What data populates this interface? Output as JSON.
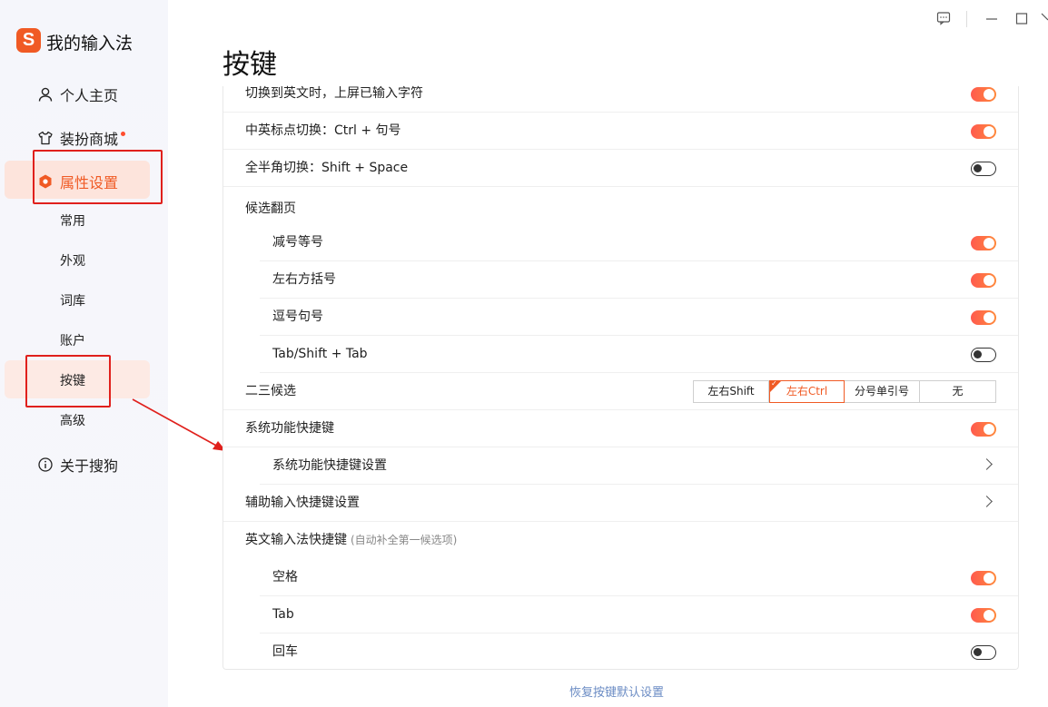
{
  "app": {
    "logo_glyph": "S",
    "title": "我的输入法"
  },
  "sidebar": {
    "items": [
      {
        "label": "个人主页",
        "icon": "user-icon"
      },
      {
        "label": "装扮商城",
        "icon": "shirt-icon",
        "badge_dot": true
      },
      {
        "label": "属性设置",
        "icon": "settings-hex-icon",
        "active": true
      },
      {
        "label": "关于搜狗",
        "icon": "info-icon"
      }
    ],
    "subitems": [
      {
        "label": "常用"
      },
      {
        "label": "外观"
      },
      {
        "label": "词库"
      },
      {
        "label": "账户"
      },
      {
        "label": "按键",
        "active": true
      },
      {
        "label": "高级"
      }
    ]
  },
  "window_controls": [
    "feedback-icon",
    "minimize-icon",
    "maximize-icon",
    "close-icon"
  ],
  "page": {
    "title": "按键"
  },
  "settings": {
    "row1": {
      "label": "切换到英文时，上屏已输入字符",
      "on": true
    },
    "row2": {
      "label": "中英标点切换：Ctrl + 句号",
      "on": true
    },
    "row3": {
      "label": "全半角切换：Shift + Space",
      "on": false
    },
    "candidate_page": {
      "label": "候选翻页"
    },
    "cp1": {
      "label": "减号等号",
      "on": true
    },
    "cp2": {
      "label": "左右方括号",
      "on": true
    },
    "cp3": {
      "label": "逗号句号",
      "on": true
    },
    "cp4": {
      "label": "Tab/Shift + Tab",
      "on": false
    },
    "second_third": {
      "label": "二三候选",
      "options": [
        "左右Shift",
        "左右Ctrl",
        "分号单引号",
        "无"
      ],
      "selected": "左右Ctrl"
    },
    "sys_shortcut": {
      "label": "系统功能快捷键",
      "on": true
    },
    "sys_shortcut_settings": {
      "label": "系统功能快捷键设置"
    },
    "aux_shortcut_settings": {
      "label": "辅助输入快捷键设置"
    },
    "english_shortcut": {
      "label": "英文输入法快捷键",
      "hint": "(自动补全第一候选项)"
    },
    "en1": {
      "label": "空格",
      "on": true
    },
    "en2": {
      "label": "Tab",
      "on": true
    },
    "en3": {
      "label": "回车",
      "on": false
    }
  },
  "footer": {
    "restore_label": "恢复按键默认设置"
  },
  "colors": {
    "accent": "#f05a24",
    "annotation": "#e0201c",
    "link": "#6b8cc4"
  }
}
